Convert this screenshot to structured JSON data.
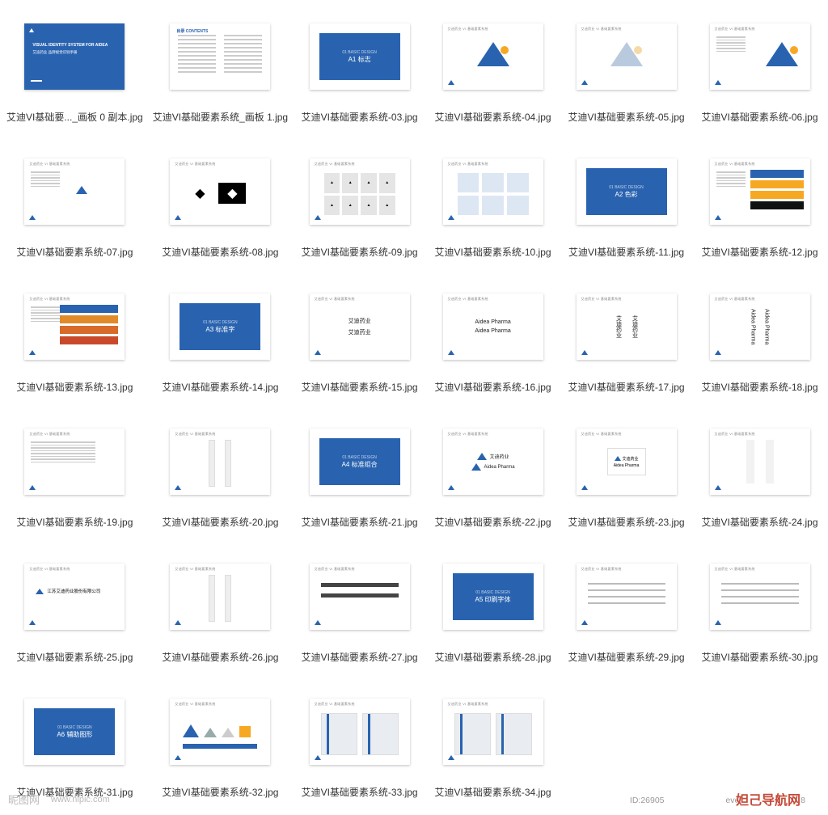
{
  "files": [
    {
      "name": "艾迪VI基础要..._画板 0 副本.jpg",
      "kind": "cover"
    },
    {
      "name": "艾迪VI基础要素系统_画板 1.jpg",
      "kind": "contents"
    },
    {
      "name": "艾迪VI基础要素系统-03.jpg",
      "kind": "section",
      "label": "A1 标志"
    },
    {
      "name": "艾迪VI基础要素系统-04.jpg",
      "kind": "triangle"
    },
    {
      "name": "艾迪VI基础要素系统-05.jpg",
      "kind": "triangle-pale"
    },
    {
      "name": "艾迪VI基础要素系统-06.jpg",
      "kind": "triangle-right"
    },
    {
      "name": "艾迪VI基础要素系统-07.jpg",
      "kind": "logo-small"
    },
    {
      "name": "艾迪VI基础要素系统-08.jpg",
      "kind": "bw"
    },
    {
      "name": "艾迪VI基础要素系统-09.jpg",
      "kind": "grid9"
    },
    {
      "name": "艾迪VI基础要素系统-10.jpg",
      "kind": "grid6"
    },
    {
      "name": "艾迪VI基础要素系统-11.jpg",
      "kind": "section",
      "label": "A2 色彩"
    },
    {
      "name": "艾迪VI基础要素系统-12.jpg",
      "kind": "bars"
    },
    {
      "name": "艾迪VI基础要素系统-13.jpg",
      "kind": "bars2"
    },
    {
      "name": "艾迪VI基础要素系统-14.jpg",
      "kind": "section",
      "label": "A3 标准字"
    },
    {
      "name": "艾迪VI基础要素系统-15.jpg",
      "kind": "text",
      "lines": [
        "艾迪药业",
        "艾迪药业"
      ]
    },
    {
      "name": "艾迪VI基础要素系统-16.jpg",
      "kind": "text",
      "lines": [
        "Aidea Pharma",
        "Aidea Pharma"
      ]
    },
    {
      "name": "艾迪VI基础要素系统-17.jpg",
      "kind": "text-vert",
      "lines": [
        "艾迪药业",
        "艾迪药业"
      ]
    },
    {
      "name": "艾迪VI基础要素系统-18.jpg",
      "kind": "text-vert",
      "lines": [
        "Aidea Pharma",
        "Aidea Pharma"
      ]
    },
    {
      "name": "艾迪VI基础要素系统-19.jpg",
      "kind": "para"
    },
    {
      "name": "艾迪VI基础要素系统-20.jpg",
      "kind": "vstrips"
    },
    {
      "name": "艾迪VI基础要素系统-21.jpg",
      "kind": "section",
      "label": "A4 标准组合"
    },
    {
      "name": "艾迪VI基础要素系统-22.jpg",
      "kind": "logo-combo",
      "lines": [
        "艾迪药业",
        "Aidea Pharma"
      ]
    },
    {
      "name": "艾迪VI基础要素系统-23.jpg",
      "kind": "logo-combo-box",
      "lines": [
        "艾迪药业",
        "Aidea Pharma"
      ]
    },
    {
      "name": "艾迪VI基础要素系统-24.jpg",
      "kind": "logo-combo-vert"
    },
    {
      "name": "艾迪VI基础要素系统-25.jpg",
      "kind": "company-line"
    },
    {
      "name": "艾迪VI基础要素系统-26.jpg",
      "kind": "vstrips"
    },
    {
      "name": "艾迪VI基础要素系统-27.jpg",
      "kind": "hlines"
    },
    {
      "name": "艾迪VI基础要素系统-28.jpg",
      "kind": "section",
      "label": "A5 印刷字体"
    },
    {
      "name": "艾迪VI基础要素系统-29.jpg",
      "kind": "textlines"
    },
    {
      "name": "艾迪VI基础要素系统-30.jpg",
      "kind": "textlines"
    },
    {
      "name": "艾迪VI基础要素系统-31.jpg",
      "kind": "section",
      "label": "A6 辅助图形"
    },
    {
      "name": "艾迪VI基础要素系统-32.jpg",
      "kind": "shapes"
    },
    {
      "name": "艾迪VI基础要素系统-33.jpg",
      "kind": "photos"
    },
    {
      "name": "艾迪VI基础要素系统-34.jpg",
      "kind": "photos"
    }
  ],
  "cover_title": "VISUAL IDENTITY SYSTEM FOR AIDEA",
  "cover_sub": "艾迪药业 品牌视觉识别手册",
  "contents_title": "目录 CONTENTS",
  "watermark1": "昵图网",
  "watermark2": "www.nipic.com",
  "footer_id": "ID:26905",
  "footer_ext": "eve",
  "footer_num": "8",
  "bottom_brand": "妲己导航网"
}
